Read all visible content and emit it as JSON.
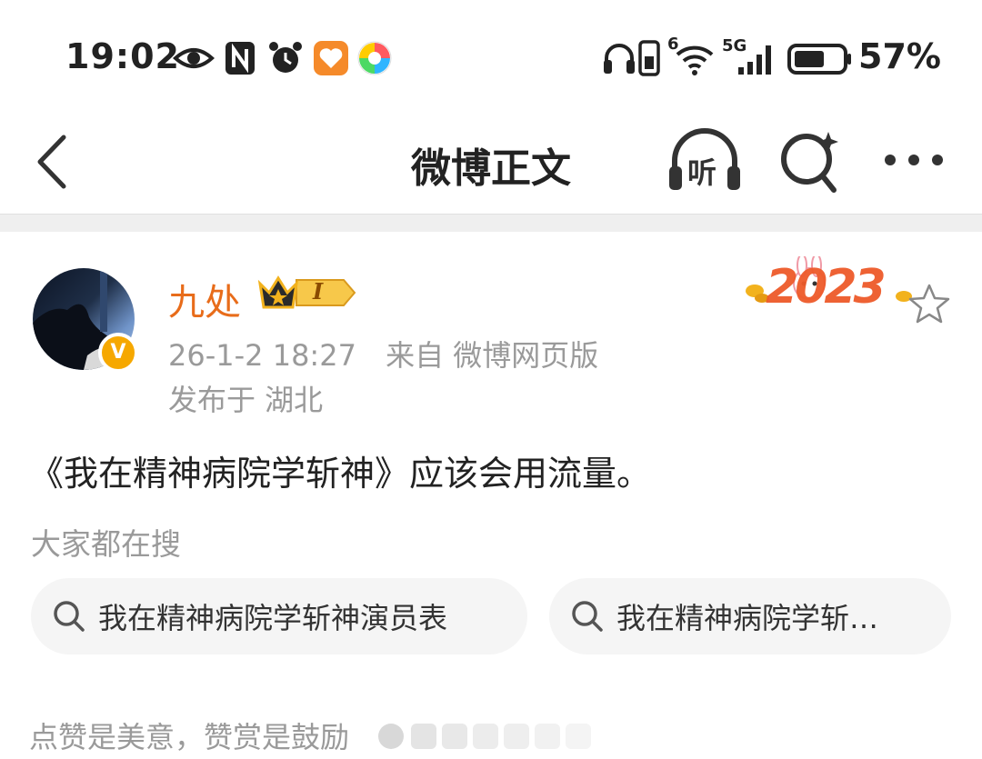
{
  "status_bar": {
    "time": "19:02",
    "battery_percent": "57%",
    "signal_label": "5G",
    "wifi_label": "6",
    "left_icons": [
      "eye-icon",
      "nfc-icon",
      "alarm-icon",
      "heart-app-icon",
      "colorful-app-icon"
    ],
    "right_icons": [
      "headphones-icon",
      "phone-icon",
      "wifi-icon",
      "signal-icon",
      "battery-icon"
    ]
  },
  "nav": {
    "title": "微博正文",
    "listen_label": "听"
  },
  "post": {
    "author": "九处",
    "level_badge": "I",
    "time": "26-1-2 18:27",
    "source": "来自 微博网页版",
    "location": "发布于 湖北",
    "text": "《我在精神病院学斩神》应该会用流量。",
    "sticker": "2023",
    "accent_color": "#e86c1a"
  },
  "hot_search": {
    "label": "大家都在搜",
    "items": [
      {
        "text": "我在精神病院学斩神演员表"
      },
      {
        "text": "我在精神病院学斩…"
      }
    ]
  },
  "footer": {
    "hint": "点赞是美意，赞赏是鼓励"
  }
}
